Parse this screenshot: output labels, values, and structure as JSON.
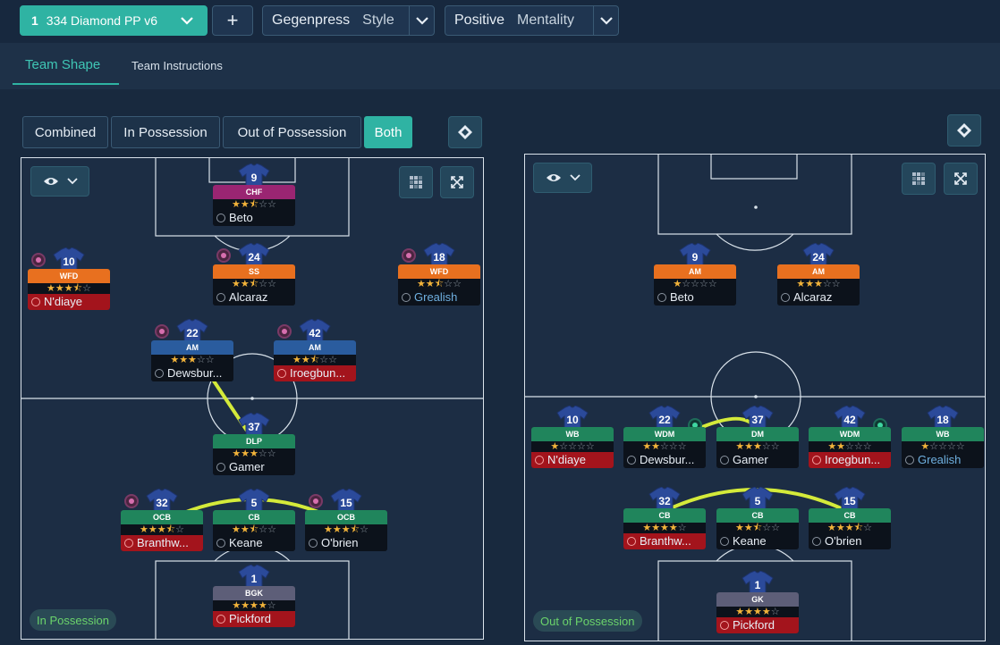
{
  "topbar": {
    "tactic_number": "1",
    "tactic_name": "334 Diamond PP v6",
    "add_label": "+",
    "style_value": "Gegenpress",
    "style_label": "Style",
    "mentality_value": "Positive",
    "mentality_label": "Mentality"
  },
  "tabs": [
    {
      "label": "Team Shape",
      "active": true
    },
    {
      "label": "Team Instructions",
      "active": false
    }
  ],
  "view_toggle": [
    {
      "label": "Combined",
      "active": false
    },
    {
      "label": "In Possession",
      "active": false
    },
    {
      "label": "Out of Possession",
      "active": false
    },
    {
      "label": "Both",
      "active": true
    }
  ],
  "left_pitch": {
    "phase": "In Possession",
    "players": [
      {
        "number": "9",
        "role": "CHF",
        "stars": 2.5,
        "name": "Beto",
        "color": "#9a2572",
        "name_style": "",
        "marker": false
      },
      {
        "number": "10",
        "role": "WFD",
        "stars": 3.5,
        "name": "N'diaye",
        "color": "#e8701f",
        "name_style": "red",
        "marker": true
      },
      {
        "number": "24",
        "role": "SS",
        "stars": 2.5,
        "name": "Alcaraz",
        "color": "#e8701f",
        "name_style": "",
        "marker": true
      },
      {
        "number": "18",
        "role": "WFD",
        "stars": 2.5,
        "name": "Grealish",
        "color": "#e8701f",
        "name_style": "blue",
        "marker": true
      },
      {
        "number": "22",
        "role": "AM",
        "stars": 3,
        "name": "Dewsbur...",
        "color": "#2a5c9e",
        "name_style": "",
        "marker": true
      },
      {
        "number": "42",
        "role": "AM",
        "stars": 2.5,
        "name": "Iroegbun...",
        "color": "#2a5c9e",
        "name_style": "red",
        "marker": true
      },
      {
        "number": "37",
        "role": "DLP",
        "stars": 3,
        "name": "Gamer",
        "color": "#20855c",
        "name_style": "",
        "marker": false
      },
      {
        "number": "32",
        "role": "OCB",
        "stars": 3.5,
        "name": "Branthw...",
        "color": "#20855c",
        "name_style": "red",
        "marker": true
      },
      {
        "number": "5",
        "role": "CB",
        "stars": 2.5,
        "name": "Keane",
        "color": "#20855c",
        "name_style": "",
        "marker": false
      },
      {
        "number": "15",
        "role": "OCB",
        "stars": 3.5,
        "name": "O'brien",
        "color": "#20855c",
        "name_style": "",
        "marker": true
      },
      {
        "number": "1",
        "role": "BGK",
        "stars": 4,
        "name": "Pickford",
        "color": "#5d5e78",
        "name_style": "red",
        "marker": false
      }
    ]
  },
  "right_pitch": {
    "phase": "Out of Possession",
    "players": [
      {
        "number": "9",
        "role": "AM",
        "stars": 1,
        "name": "Beto",
        "color": "#e8701f",
        "name_style": "",
        "marker": false
      },
      {
        "number": "24",
        "role": "AM",
        "stars": 3,
        "name": "Alcaraz",
        "color": "#e8701f",
        "name_style": "",
        "marker": false
      },
      {
        "number": "10",
        "role": "WB",
        "stars": 1,
        "name": "N'diaye",
        "color": "#20855c",
        "name_style": "red",
        "marker": false
      },
      {
        "number": "22",
        "role": "WDM",
        "stars": 2,
        "name": "Dewsbur...",
        "color": "#20855c",
        "name_style": "",
        "marker": true
      },
      {
        "number": "37",
        "role": "DM",
        "stars": 3,
        "name": "Gamer",
        "color": "#20855c",
        "name_style": "",
        "marker": false
      },
      {
        "number": "42",
        "role": "WDM",
        "stars": 2,
        "name": "Iroegbun...",
        "color": "#20855c",
        "name_style": "red",
        "marker": true
      },
      {
        "number": "18",
        "role": "WB",
        "stars": 1,
        "name": "Grealish",
        "color": "#20855c",
        "name_style": "blue",
        "marker": false
      },
      {
        "number": "32",
        "role": "CB",
        "stars": 4,
        "name": "Branthw...",
        "color": "#20855c",
        "name_style": "red",
        "marker": false
      },
      {
        "number": "5",
        "role": "CB",
        "stars": 2.5,
        "name": "Keane",
        "color": "#20855c",
        "name_style": "",
        "marker": false
      },
      {
        "number": "15",
        "role": "CB",
        "stars": 3.5,
        "name": "O'brien",
        "color": "#20855c",
        "name_style": "",
        "marker": false
      },
      {
        "number": "1",
        "role": "GK",
        "stars": 4,
        "name": "Pickford",
        "color": "#5d5e78",
        "name_style": "red",
        "marker": false
      }
    ]
  },
  "colors": {
    "accent": "#2fb3a3",
    "link_line": "#d4ea3a",
    "pitch_line": "#d9e2ea"
  },
  "icons": {
    "eye": "eye-icon",
    "dropdown": "chevron-down-icon",
    "grid": "grid-icon",
    "expand": "expand-arrows-icon",
    "pitch_view": "pitch-diamond-icon"
  }
}
